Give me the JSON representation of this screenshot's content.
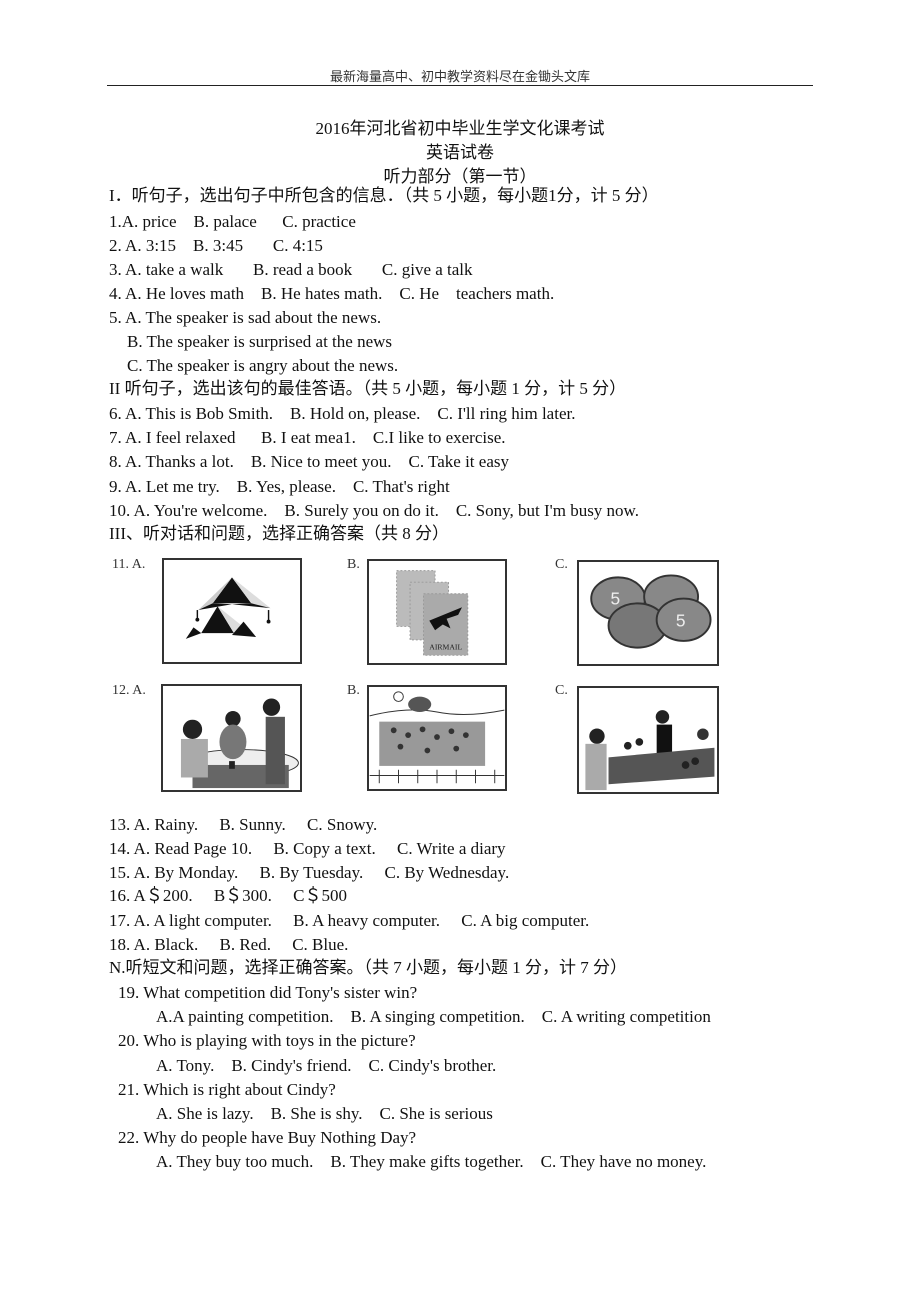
{
  "header": {
    "banner": "最新海量高中、初中教学资料尽在金锄头文库"
  },
  "title": {
    "main": "2016年河北省初中毕业生学文化课考试",
    "sub": "英语试卷",
    "part": "听力部分（第一节）"
  },
  "sections": {
    "s1": {
      "heading": "I．听句子，选出句子中所包含的信息．（共 5 小题，每小题1分，计 5 分）",
      "questions": [
        {
          "text": "1.A. price    B. palace      C. practice"
        },
        {
          "text": "2. A. 3:15    B. 3:45       C. 4:15"
        },
        {
          "text": "3. A. take a walk       B. read a book       C. give a talk"
        },
        {
          "text": "4. A. He loves math    B. He hates math.    C. He    teachers math."
        },
        {
          "text": "5. A. The speaker is sad about the news."
        },
        {
          "text": "B. The speaker is surprised at the news"
        },
        {
          "text": "C. The speaker is angry about the news."
        }
      ]
    },
    "s2": {
      "heading": "II 听句子，选出该句的最佳答语。（共 5 小题，每小题 1 分，计 5 分）",
      "questions": [
        {
          "text": "6. A. This is Bob Smith.    B. Hold on, please.    C. I'll ring him later."
        },
        {
          "text": "7. A. I feel relaxed      B. I eat mea1.    C.I like to exercise."
        },
        {
          "text": "8. A. Thanks a lot.    B. Nice to meet you.    C. Take it easy"
        },
        {
          "text": "9. A. Let me try.    B. Yes, please.    C. That's right"
        },
        {
          "text": "10. A. You're welcome.    B. Surely you on do it.    C. Sony, but I'm busy now."
        }
      ]
    },
    "s3": {
      "heading": "III、听对话和问题，选择正确答案（共 8 分）",
      "picture_questions": [
        {
          "number_label": "11. A.",
          "options": [
            {
              "label": "11. A.",
              "picture": "kites"
            },
            {
              "label": "B.",
              "picture": "airmail stamps"
            },
            {
              "label": "C.",
              "picture": "coins"
            }
          ]
        },
        {
          "number_label": "12. A.",
          "options": [
            {
              "label": "12. A.",
              "picture": "restaurant"
            },
            {
              "label": "B.",
              "picture": "park crowd"
            },
            {
              "label": "C.",
              "picture": "market stall"
            }
          ]
        }
      ],
      "questions": [
        {
          "text": "13. A. Rainy.     B. Sunny.     C. Snowy."
        },
        {
          "text": "14. A. Read Page 10.     B. Copy a text.     C. Write a diary"
        },
        {
          "text": "15. A. By Monday.     B. By Tuesday.     C. By Wednesday."
        },
        {
          "text": "16. A＄200.     B＄300.     C＄500"
        },
        {
          "text": "17. A. A light computer.     B. A heavy computer.     C. A big computer."
        },
        {
          "text": "18. A. Black.     B. Red.     C. Blue."
        }
      ]
    },
    "s4": {
      "heading": "N.听短文和问题，选择正确答案。（共 7 小题，每小题 1 分，计 7 分）",
      "questions": [
        {
          "q": "19. What competition did Tony's sister win?",
          "a": "A.A painting competition.    B. A singing competition.    C. A writing competition"
        },
        {
          "q": "20. Who is playing with toys in the picture?",
          "a": "A. Tony.    B. Cindy's friend.    C. Cindy's brother."
        },
        {
          "q": "21. Which is right about Cindy?",
          "a": "A. She is lazy.    B. She is shy.    C. She is serious"
        },
        {
          "q": "22. Why do people have Buy Nothing Day?",
          "a": "A. They buy too much.    B. They make gifts together.    C. They have no money."
        }
      ]
    }
  }
}
